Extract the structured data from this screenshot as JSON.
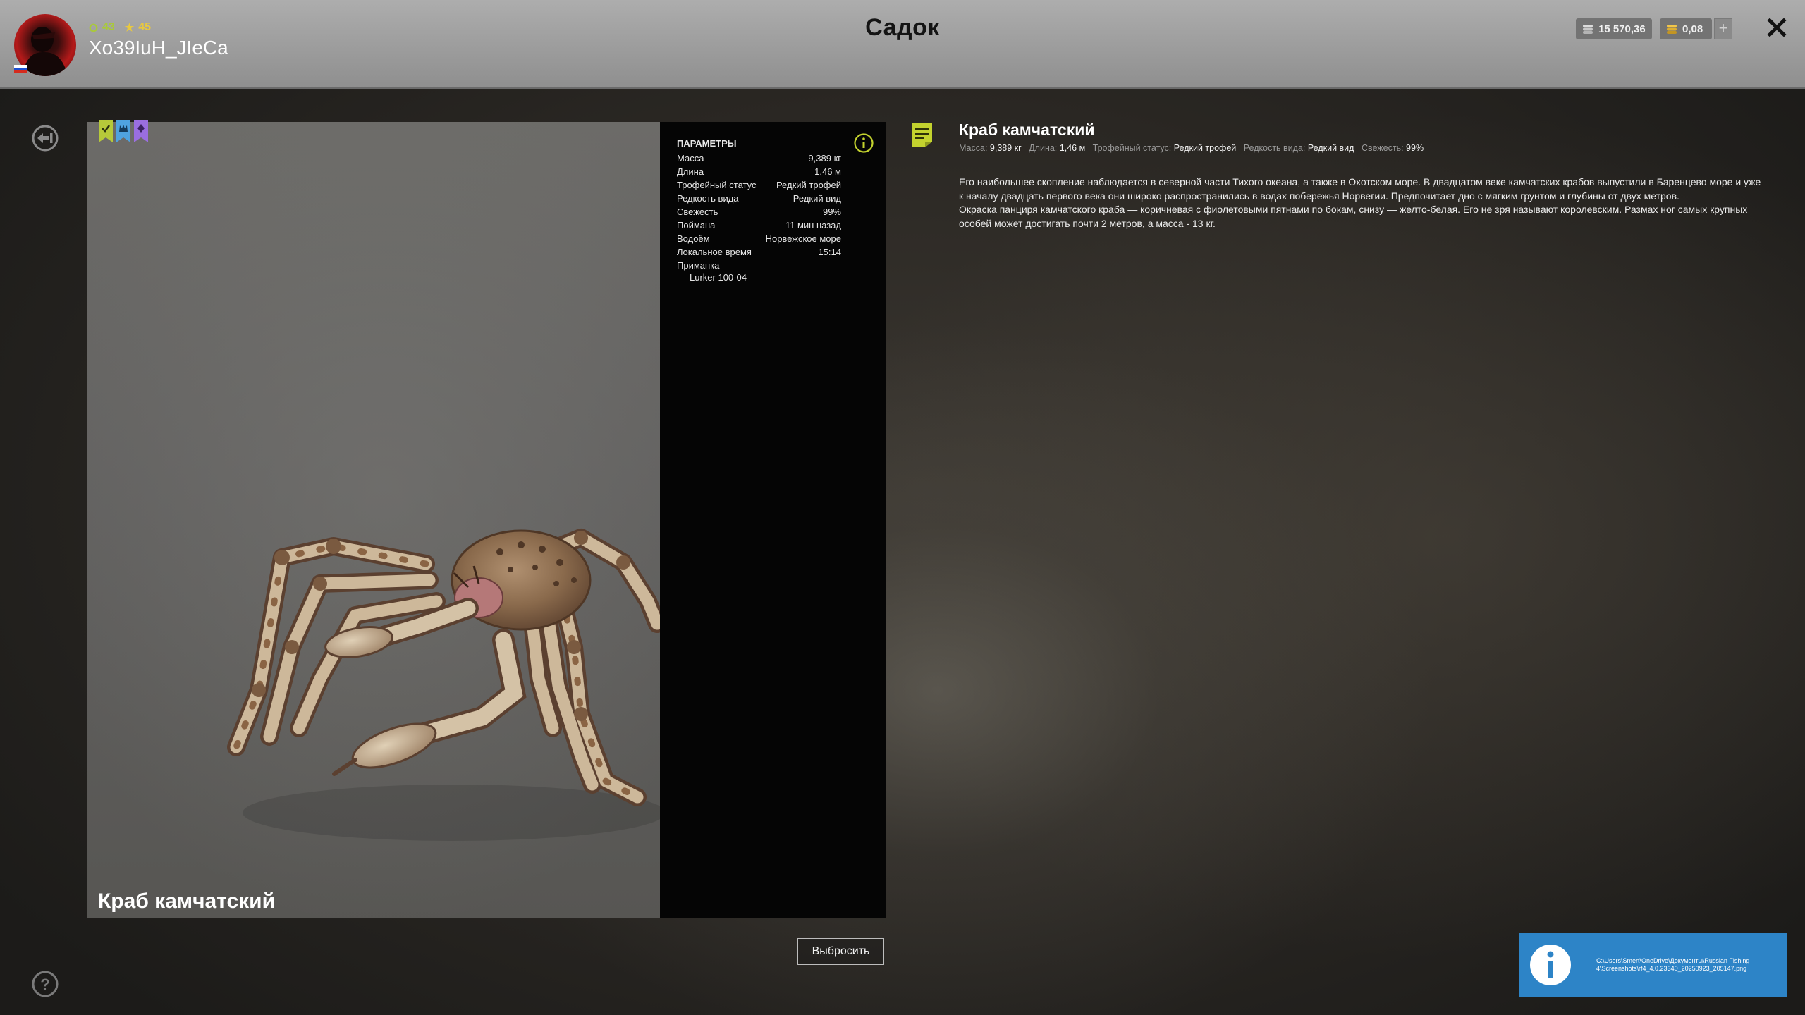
{
  "header": {
    "title": "Садок",
    "close_icon": "close-icon"
  },
  "player": {
    "name": "Xo39IuH_JIeCa",
    "level": "43",
    "rank": "45",
    "avatar_icon": "avatar",
    "flag_icon": "russia-flag-icon"
  },
  "currency": {
    "silver": "15 570,36",
    "gold": "0,08",
    "add_label": "+"
  },
  "fish": {
    "name": "Краб камчатский",
    "badges": [
      "trophy-ribbon-icon",
      "crown-ribbon-icon",
      "rare-ribbon-icon"
    ],
    "params_title": "ПАРАМЕТРЫ",
    "params": [
      {
        "label": "Масса",
        "value": "9,389 кг"
      },
      {
        "label": "Длина",
        "value": "1,46 м"
      },
      {
        "label": "Трофейный статус",
        "value": "Редкий трофей"
      },
      {
        "label": "Редкость вида",
        "value": "Редкий вид"
      },
      {
        "label": "Свежесть",
        "value": "99%"
      },
      {
        "label": "Поймана",
        "value": "11 мин назад"
      },
      {
        "label": "Водоём",
        "value": "Норвежское море"
      },
      {
        "label": "Локальное время",
        "value": "15:14"
      }
    ],
    "bait": {
      "label": "Приманка",
      "value": "Lurker 100-04"
    }
  },
  "summary": [
    {
      "label": "Масса:",
      "value": "9,389 кг"
    },
    {
      "label": "Длина:",
      "value": "1,46 м"
    },
    {
      "label": "Трофейный статус:",
      "value": "Редкий трофей"
    },
    {
      "label": "Редкость вида:",
      "value": "Редкий вид"
    },
    {
      "label": "Свежесть:",
      "value": "99%"
    }
  ],
  "description": [
    "Его наибольшее скопление наблюдается в северной части Тихого океана, а также в Охотском море. В двадцатом веке камчатских крабов выпустили в Баренцево море и уже к началу двадцать первого века они широко распространились в водах побережья Норвегии. Предпочитает дно с мягким грунтом и глубины от двух метров.",
    "Окраска панциря камчатского краба — коричневая с фиолетовыми пятнами по бокам, снизу — желто-белая. Его не зря называют королевским. Размах ног самых крупных особей может достигать почти 2 метров, а масса - 13 кг."
  ],
  "release_button": "Выбросить",
  "notification": {
    "path_lines": [
      "C:\\Users\\Smert\\OneDrive\\Документы\\Russian Fishing",
      "4\\Screenshots\\rf4_4.0.23340_20250923_205147.png"
    ]
  },
  "colors": {
    "accent": "#c3d22e",
    "level_green": "#a9c93a",
    "rank_yellow": "#e8c840",
    "notification_blue": "#2d84c7"
  }
}
